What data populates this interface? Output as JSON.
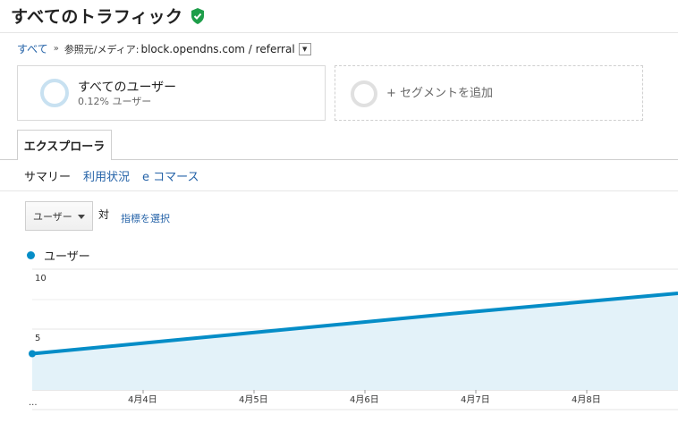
{
  "header": {
    "title": "すべてのトラフィック",
    "verified_icon": "shield-check-icon",
    "icon_color": "#1e9e4a"
  },
  "breadcrumb": {
    "root": "すべて",
    "separator": "»",
    "label": "参照元/メディア:",
    "value": "block.opendns.com / referral"
  },
  "segments": {
    "active": {
      "name": "すべてのユーザー",
      "share": "0.12% ユーザー"
    },
    "add_label": "+ セグメントを追加"
  },
  "tabs": {
    "explorer": "エクスプローラ"
  },
  "subtabs": {
    "summary": "サマリー",
    "usage": "利用状況",
    "ecommerce": "e コマース"
  },
  "controls": {
    "metric": "ユーザー",
    "vs": "対",
    "select_metric": "指標を選択"
  },
  "legend": {
    "series_name": "ユーザー",
    "color": "#058dc7"
  },
  "chart_data": {
    "type": "area",
    "series": [
      {
        "name": "ユーザー",
        "color": "#058dc7"
      }
    ],
    "x": [
      "...",
      "4月4日",
      "4月5日",
      "4月6日",
      "4月7日",
      "4月8日"
    ],
    "values": [
      3,
      4.7,
      6.4,
      8
    ],
    "value_x_positions_days": [
      0,
      2,
      4,
      6
    ],
    "yticks": [
      "5",
      "10"
    ],
    "ylim": [
      0,
      10
    ],
    "first_label": "..."
  }
}
